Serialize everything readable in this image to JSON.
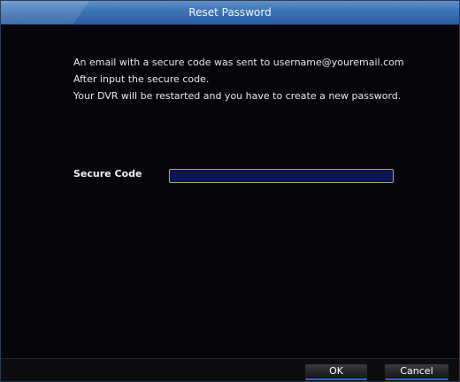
{
  "dialog": {
    "title": "Reset Password"
  },
  "messages": {
    "line1": "An email with a secure code was sent to username@youremail.com",
    "line2": "After input the secure code.",
    "line3": "Your DVR will be restarted and you have to create a new password."
  },
  "form": {
    "secure_code_label": "Secure Code",
    "secure_code_value": ""
  },
  "buttons": {
    "ok_label": "OK",
    "cancel_label": "Cancel"
  },
  "colors": {
    "titlebar": "#3d73b6",
    "input_background": "#0b1652",
    "input_border": "#b9a264",
    "button_underline": "#2c66c9"
  }
}
